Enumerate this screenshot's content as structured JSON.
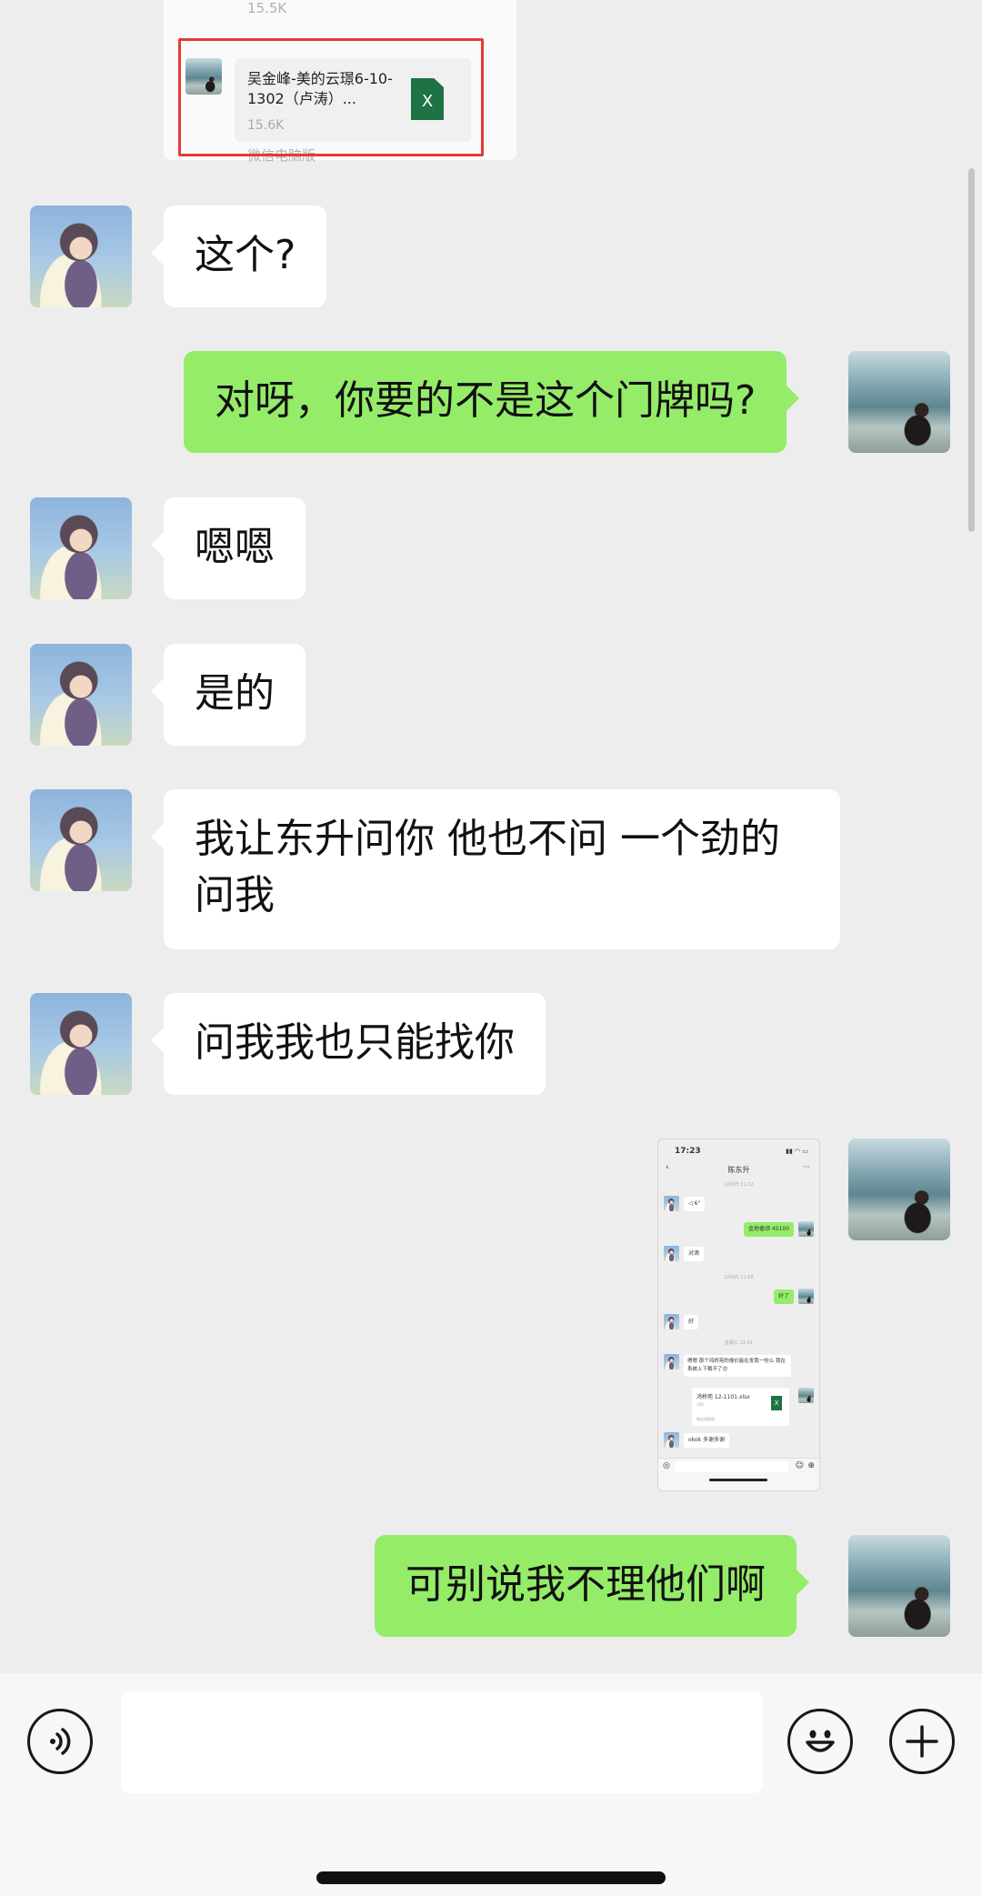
{
  "file_card": {
    "top_meta": "15.5K",
    "file_title": "吴金峰-美的云璟6-10-1302（卢涛）...",
    "file_size": "15.6K",
    "file_icon": "X",
    "source_label": "微信电脑版"
  },
  "messages": [
    {
      "side": "in",
      "text": "这个?"
    },
    {
      "side": "out",
      "text": "对呀，你要的不是这个门牌吗?"
    },
    {
      "side": "in",
      "text": "嗯嗯"
    },
    {
      "side": "in",
      "text": "是的"
    },
    {
      "side": "in",
      "text": "我让东升问你 他也不问 一个劲的\n问我"
    },
    {
      "side": "in",
      "text": "问我我也只能找你"
    },
    {
      "side": "out",
      "text": "可别说我不理他们啊"
    }
  ],
  "screenshot_thumb": {
    "status_time": "17:23",
    "status_icons": "▮▮ ◠ ▭",
    "nav_back": "‹",
    "nav_title": "陈东升",
    "nav_more": "···",
    "timestamps": [
      "1月6日 11:12",
      "1月6日 11:58",
      "星期三 11:41"
    ],
    "m1": "◁ 6\"",
    "m2": "金地香颂 45100",
    "m3": "对滴",
    "m4": "好了",
    "m5": "好",
    "m6": "嗯嗯 那个鸿桥苑的报价能在发我一份么 我在系统上下载不了😊",
    "file_name": "鸿桥苑 12-1101.xlsx",
    "file_size": "16K",
    "file_source": "微信电脑版",
    "m7": "okok 多谢多谢"
  },
  "input_bar": {
    "voice_icon": "voice-icon",
    "emoji_icon": "emoji-icon",
    "plus_icon": "plus-icon",
    "input_value": ""
  },
  "colors": {
    "background": "#ededed",
    "incoming_bubble": "#ffffff",
    "outgoing_bubble": "#95ec69",
    "highlight": "#e53935",
    "excel_green": "#1f7244"
  }
}
